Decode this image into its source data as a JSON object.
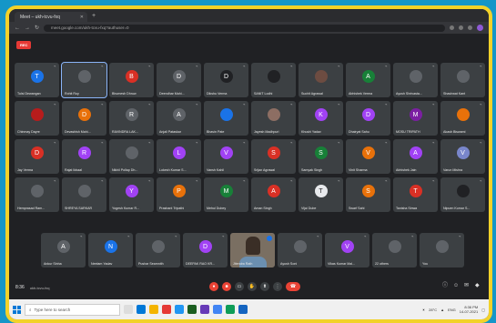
{
  "browser": {
    "tab_title": "Meet – ukh-tcvu-fxq",
    "url": "meet.google.com/ukh-tcvu-fxq?authuser=0"
  },
  "rec_label": "REC",
  "participants": [
    {
      "name": "Tulsi Dewangan",
      "initial": "T",
      "color": "#1a73e8"
    },
    {
      "name": "Rohit Roy",
      "initial": "",
      "color": "#5f6368",
      "active": true
    },
    {
      "name": "Bhumesh Dhruw",
      "initial": "B",
      "color": "#d93025"
    },
    {
      "name": "Deendhar Mahi...",
      "initial": "D",
      "color": "#5f6368"
    },
    {
      "name": "Dikshu Verma",
      "initial": "D",
      "color": "#202124"
    },
    {
      "name": "SANIT Lodhi",
      "initial": "",
      "color": "#202124"
    },
    {
      "name": "Suchit Agrawal",
      "initial": "",
      "color": "#6d4c41"
    },
    {
      "name": "Abhishek Verma",
      "initial": "A",
      "color": "#188038"
    },
    {
      "name": "Ayush Shrivasta...",
      "initial": "",
      "color": "#5f6368"
    },
    {
      "name": "Shashwat Kant",
      "initial": "",
      "color": "#5f6368"
    },
    {
      "name": "Chinmay Dayre",
      "initial": "",
      "color": "#b71c1c"
    },
    {
      "name": "Devashish Mahi...",
      "initial": "D",
      "color": "#e8710a"
    },
    {
      "name": "RAVINDRA LAK...",
      "initial": "R",
      "color": "#5f6368"
    },
    {
      "name": "Anjali Pataskar",
      "initial": "A",
      "color": "#5f6368"
    },
    {
      "name": "Bhavin Pate",
      "initial": "",
      "color": "#1a73e8"
    },
    {
      "name": "Jayesh Madhpuri",
      "initial": "",
      "color": "#8d6e63"
    },
    {
      "name": "Khushi Yadav",
      "initial": "K",
      "color": "#a142f4"
    },
    {
      "name": "Dhairyat Sahu",
      "initial": "D",
      "color": "#a142f4"
    },
    {
      "name": "MOSU TRIPATH",
      "initial": "M",
      "color": "#7b1fa2"
    },
    {
      "name": "Akash Biswami",
      "initial": "",
      "color": "#e8710a"
    },
    {
      "name": "Jay Verma",
      "initial": "D",
      "color": "#d93025"
    },
    {
      "name": "Rajat Ikbaal",
      "initial": "R",
      "color": "#a142f4"
    },
    {
      "name": "Nikhil Pollap Dh...",
      "initial": "",
      "color": "#5f6368"
    },
    {
      "name": "Lokesh Kumar S...",
      "initial": "L",
      "color": "#a142f4"
    },
    {
      "name": "Vansh Kahil",
      "initial": "V",
      "color": "#a142f4"
    },
    {
      "name": "Srijan Agrawal",
      "initial": "S",
      "color": "#d93025"
    },
    {
      "name": "Samyak Singh",
      "initial": "S",
      "color": "#188038"
    },
    {
      "name": "Vinit Sharma",
      "initial": "V",
      "color": "#e8710a"
    },
    {
      "name": "Abhishek Jain",
      "initial": "A",
      "color": "#a142f4"
    },
    {
      "name": "Varun Mishra",
      "initial": "V",
      "color": "#7986cb"
    },
    {
      "name": "Hemprasad Ram...",
      "initial": "",
      "color": "#5f6368"
    },
    {
      "name": "SHREYA SARKAR",
      "initial": "",
      "color": "#5f6368"
    },
    {
      "name": "Yogesh Kumar R...",
      "initial": "Y",
      "color": "#a142f4"
    },
    {
      "name": "Prashant Tripathi",
      "initial": "P",
      "color": "#e8710a"
    },
    {
      "name": "Mehul Dubey",
      "initial": "M",
      "color": "#188038"
    },
    {
      "name": "Aman Singh",
      "initial": "A",
      "color": "#d93025"
    },
    {
      "name": "Vijai Dube",
      "initial": "T",
      "color": "#e8eaed"
    },
    {
      "name": "Swarf Sahi",
      "initial": "S",
      "color": "#e8710a"
    },
    {
      "name": "Tanisha Sinwa",
      "initial": "T",
      "color": "#d93025"
    },
    {
      "name": "Nipuen Kumar S...",
      "initial": "",
      "color": "#202124"
    },
    {
      "name": "Ankur Sinha",
      "initial": "A",
      "color": "#5f6368"
    },
    {
      "name": "Neelam Yadav",
      "initial": "N",
      "color": "#1a73e8"
    },
    {
      "name": "Pushar Seamnith",
      "initial": "",
      "color": "#5f6368"
    },
    {
      "name": "DEEPAK RAO KR...",
      "initial": "D",
      "color": "#a142f4"
    },
    {
      "name": "Jitendra Rath",
      "initial": "",
      "color": "#5f6368",
      "video": true
    },
    {
      "name": "Ayush Soni",
      "initial": "",
      "color": "#5f6368"
    },
    {
      "name": "Vikas Kumar Mal...",
      "initial": "V",
      "color": "#a142f4"
    },
    {
      "name": "22 others",
      "initial": "",
      "color": "#5f6368"
    },
    {
      "name": "You",
      "initial": "",
      "color": "#5f6368"
    }
  ],
  "bottom": {
    "time": "8:36",
    "meeting_code": "ukh-tcvu-fxq"
  },
  "taskbar": {
    "search_placeholder": "Type here to search",
    "temp": "28°C",
    "lang": "ENG",
    "clock_time": "8:36 PM",
    "clock_date": "14-07-2021"
  }
}
